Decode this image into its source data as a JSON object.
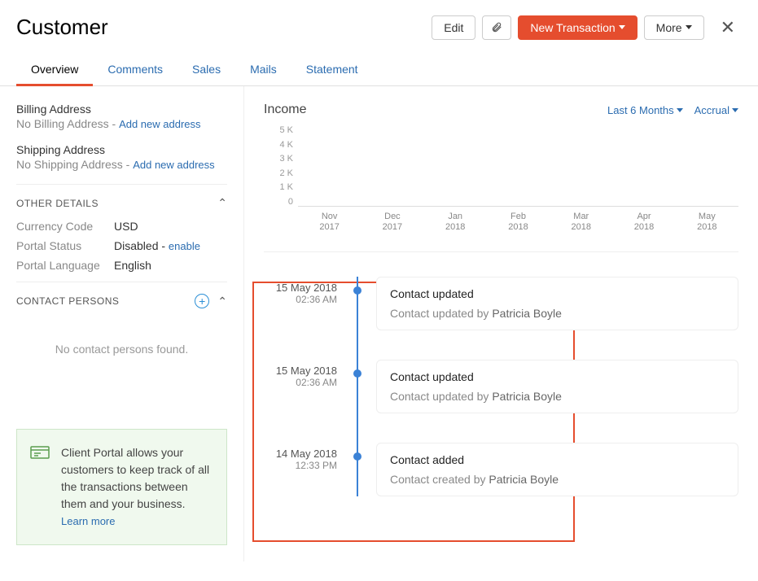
{
  "header": {
    "title": "Customer",
    "edit": "Edit",
    "new_transaction": "New Transaction",
    "more": "More"
  },
  "tabs": [
    "Overview",
    "Comments",
    "Sales",
    "Mails",
    "Statement"
  ],
  "sidebar": {
    "billing_label": "Billing Address",
    "billing_value": "No Billing Address - ",
    "billing_link": "Add new address",
    "shipping_label": "Shipping Address",
    "shipping_value": "No Shipping Address - ",
    "shipping_link": "Add new address",
    "other_details_title": "OTHER DETAILS",
    "details": [
      {
        "label": "Currency Code",
        "value": "USD"
      },
      {
        "label": "Portal Status",
        "value": "Disabled - ",
        "link": "enable"
      },
      {
        "label": "Portal Language",
        "value": "English"
      }
    ],
    "contact_persons_title": "CONTACT PERSONS",
    "contact_empty": "No contact persons found.",
    "portal_text": "Client Portal allows your customers to keep track of all the transactions between them and your business. ",
    "portal_link": "Learn more"
  },
  "income": {
    "title": "Income",
    "filter_period": "Last 6 Months",
    "filter_basis": "Accrual"
  },
  "chart_data": {
    "type": "bar",
    "categories": [
      {
        "month": "Nov",
        "year": "2017"
      },
      {
        "month": "Dec",
        "year": "2017"
      },
      {
        "month": "Jan",
        "year": "2018"
      },
      {
        "month": "Feb",
        "year": "2018"
      },
      {
        "month": "Mar",
        "year": "2018"
      },
      {
        "month": "Apr",
        "year": "2018"
      },
      {
        "month": "May",
        "year": "2018"
      }
    ],
    "values": [
      0,
      0,
      0,
      0,
      0,
      0,
      0
    ],
    "y_ticks": [
      "5 K",
      "4 K",
      "3 K",
      "2 K",
      "1 K",
      "0"
    ],
    "ylim": [
      0,
      5000
    ],
    "title": "Income"
  },
  "timeline": [
    {
      "date": "15 May 2018",
      "time": "02:36 AM",
      "title": "Contact updated",
      "desc": "Contact updated",
      "user": "Patricia Boyle"
    },
    {
      "date": "15 May 2018",
      "time": "02:36 AM",
      "title": "Contact updated",
      "desc": "Contact updated",
      "user": "Patricia Boyle"
    },
    {
      "date": "14 May 2018",
      "time": "12:33 PM",
      "title": "Contact added",
      "desc": "Contact created",
      "user": "Patricia Boyle"
    }
  ]
}
